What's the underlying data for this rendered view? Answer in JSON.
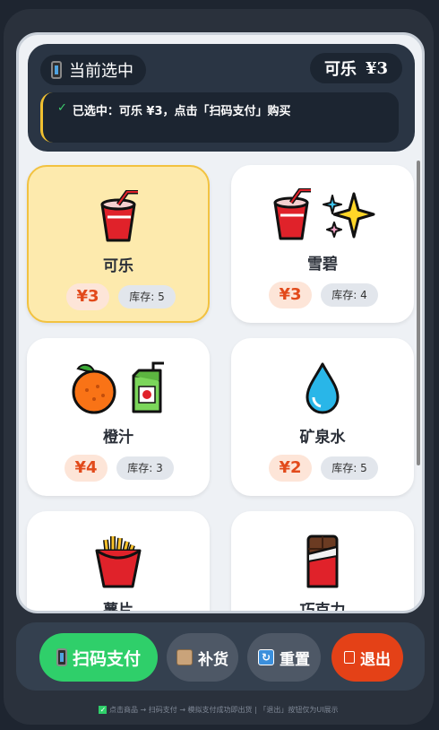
{
  "status": {
    "label": "当前选中",
    "selected_name": "可乐",
    "selected_price": "¥3",
    "hint": "已选中：可乐 ¥3，点击「扫码支付」购买"
  },
  "products": [
    {
      "name": "可乐",
      "price": "¥3",
      "stock": "库存: 5",
      "icon": "cup-icon",
      "selected": true
    },
    {
      "name": "雪碧",
      "price": "¥3",
      "stock": "库存: 4",
      "icon": "cup-sparkles-icon",
      "selected": false
    },
    {
      "name": "橙汁",
      "price": "¥4",
      "stock": "库存: 3",
      "icon": "orange-juice-box-icon",
      "selected": false
    },
    {
      "name": "矿泉水",
      "price": "¥2",
      "stock": "库存: 5",
      "icon": "droplet-icon",
      "selected": false
    },
    {
      "name": "薯片",
      "price": "",
      "stock": "",
      "icon": "fries-icon",
      "selected": false
    },
    {
      "name": "巧克力",
      "price": "",
      "stock": "",
      "icon": "chocolate-icon",
      "selected": false
    }
  ],
  "toolbar": {
    "scan_label": "扫码支付",
    "restock_label": "补货",
    "reset_label": "重置",
    "exit_label": "退出"
  },
  "footer": {
    "text": "点击商品 → 扫码支付 → 模拟支付成功即出货 | 「退出」按钮仅为UI展示"
  },
  "colors": {
    "accent_green": "#2fcf6a",
    "exit_red": "#e44117",
    "selected_card": "#fdeaad",
    "price_red": "#e24a1b"
  }
}
